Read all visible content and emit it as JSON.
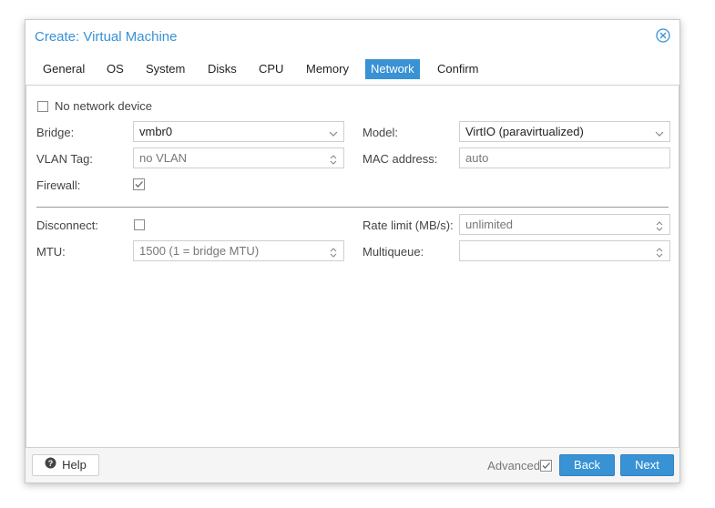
{
  "dialog": {
    "title": "Create: Virtual Machine",
    "tabs": [
      {
        "label": "General"
      },
      {
        "label": "OS"
      },
      {
        "label": "System"
      },
      {
        "label": "Disks"
      },
      {
        "label": "CPU"
      },
      {
        "label": "Memory"
      },
      {
        "label": "Network",
        "active": true
      },
      {
        "label": "Confirm"
      }
    ]
  },
  "form": {
    "no_network_device": {
      "label": "No network device",
      "checked": false
    },
    "bridge": {
      "label": "Bridge:",
      "value": "vmbr0"
    },
    "model": {
      "label": "Model:",
      "value": "VirtIO (paravirtualized)"
    },
    "vlan_tag": {
      "label": "VLAN Tag:",
      "placeholder": "no VLAN"
    },
    "mac_address": {
      "label": "MAC address:",
      "placeholder": "auto"
    },
    "firewall": {
      "label": "Firewall:",
      "checked": true
    },
    "disconnect": {
      "label": "Disconnect:",
      "checked": false
    },
    "rate_limit": {
      "label": "Rate limit (MB/s):",
      "placeholder": "unlimited"
    },
    "mtu": {
      "label": "MTU:",
      "placeholder": "1500 (1 = bridge MTU)"
    },
    "multiqueue": {
      "label": "Multiqueue:",
      "value": ""
    }
  },
  "footer": {
    "help_label": "Help",
    "advanced_label": "Advanced",
    "advanced_checked": true,
    "back_label": "Back",
    "next_label": "Next"
  },
  "colors": {
    "accent": "#3892d4",
    "border": "#cfcfcf"
  }
}
